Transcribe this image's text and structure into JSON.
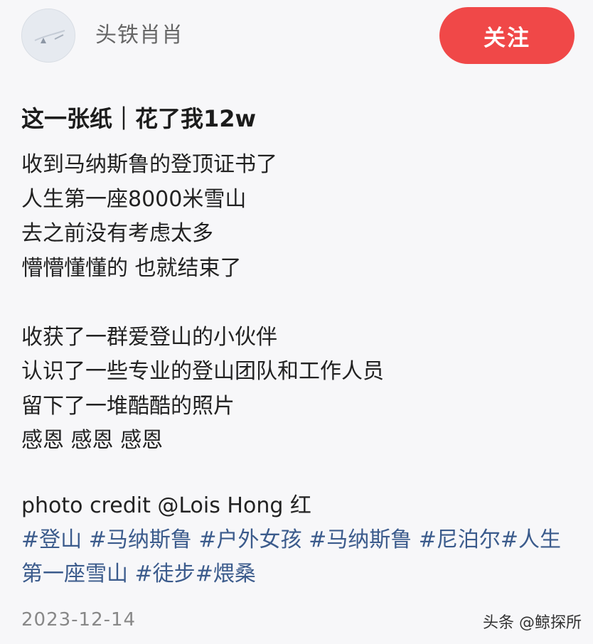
{
  "header": {
    "username": "头铁肖肖",
    "follow_label": "关注"
  },
  "post": {
    "title": "这一张纸｜花了我12w",
    "lines": [
      "收到马纳斯鲁的登顶证书了",
      "人生第一座8000米雪山",
      "去之前没有考虑太多",
      "懵懵懂懂的 也就结束了",
      "",
      "收获了一群爱登山的小伙伴",
      "认识了一些专业的登山团队和工作人员",
      "留下了一堆酷酷的照片",
      "感恩 感恩 感恩",
      ""
    ],
    "credit": "photo credit @Lois Hong 红",
    "tags": [
      "#登山",
      "#马纳斯鲁",
      "#户外女孩",
      "#马纳斯鲁",
      "#尼泊尔",
      "#人生第一座雪山",
      "#徒步",
      "#煨桑"
    ],
    "date": "2023-12-14"
  },
  "watermark": "头条 @鲸探所",
  "colors": {
    "follow_button": "#f04848",
    "tag": "#3b5b8c",
    "background": "#f7f7f9"
  },
  "icons": {
    "avatar": "avatar-image"
  }
}
